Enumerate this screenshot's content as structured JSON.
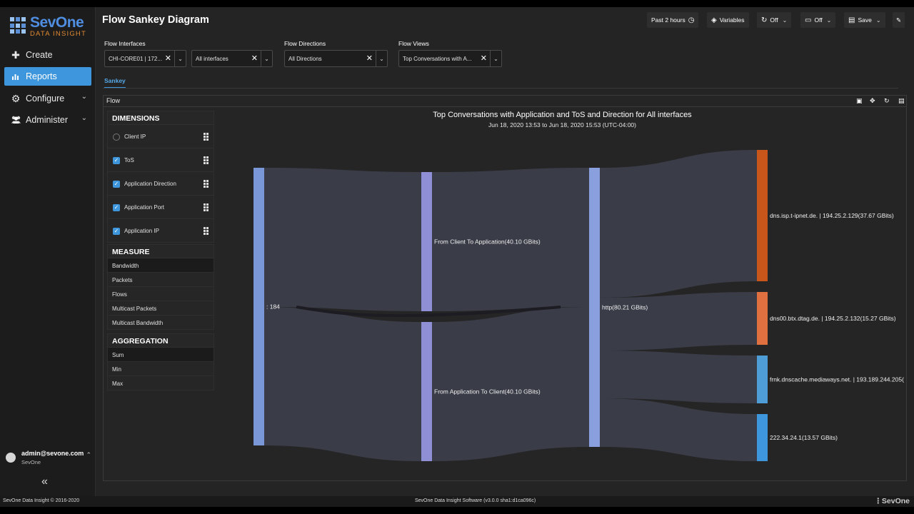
{
  "brand": {
    "name": "SevOne",
    "sub": "DATA INSIGHT"
  },
  "sidebar": {
    "items": [
      {
        "label": "Create",
        "icon": "plus-icon"
      },
      {
        "label": "Reports",
        "icon": "bar-chart-icon"
      },
      {
        "label": "Configure",
        "icon": "gear-icon"
      },
      {
        "label": "Administer",
        "icon": "users-icon"
      }
    ],
    "user": {
      "name": "admin@sevone.com",
      "org": "SevOne"
    },
    "collapse": "«"
  },
  "header": {
    "title": "Flow Sankey Diagram",
    "time_range": "Past 2 hours",
    "variables": "Variables",
    "refresh": "Off",
    "display": "Off",
    "save": "Save"
  },
  "filters": [
    {
      "label": "Flow Interfaces",
      "value": "CHI-CORE01 | 172...",
      "extra": "All interfaces"
    },
    {
      "label": "Flow Directions",
      "value": "All Directions"
    },
    {
      "label": "Flow Views",
      "value": "Top Conversations with A..."
    }
  ],
  "tab": "Sankey",
  "panel": {
    "title": "Flow"
  },
  "dimensions": {
    "title": "DIMENSIONS",
    "items": [
      {
        "label": "Client IP",
        "checked": false
      },
      {
        "label": "ToS",
        "checked": true
      },
      {
        "label": "Application Direction",
        "checked": true
      },
      {
        "label": "Application Port",
        "checked": true
      },
      {
        "label": "Application IP",
        "checked": true
      }
    ]
  },
  "measure": {
    "title": "MEASURE",
    "items": [
      "Bandwidth",
      "Packets",
      "Flows",
      "Multicast Packets",
      "Multicast Bandwidth"
    ],
    "selected": "Bandwidth"
  },
  "aggregation": {
    "title": "AGGREGATION",
    "items": [
      "Sum",
      "Min",
      "Max"
    ],
    "selected": "Sum"
  },
  "chart": {
    "title": "Top Conversations with Application and ToS and Direction for All interfaces",
    "subtitle": "Jun 18, 2020 13:53 to Jun 18, 2020 15:53 (UTC-04:00)"
  },
  "chart_data": {
    "type": "sankey",
    "unit": "GBits",
    "nodes": [
      {
        "id": "tos",
        "label": ": 184",
        "stage": 0,
        "color": "#7a98d8"
      },
      {
        "id": "c2a",
        "label": "From Client To Application(40.10 GBits)",
        "stage": 1,
        "color": "#8f8fd6",
        "value": 40.1
      },
      {
        "id": "a2c",
        "label": "From Application To Client(40.10 GBits)",
        "stage": 1,
        "color": "#8f8fd6",
        "value": 40.1
      },
      {
        "id": "http",
        "label": "http(80.21 GBits)",
        "stage": 2,
        "color": "#8aa0de",
        "value": 80.21
      },
      {
        "id": "ip1",
        "label": "dns.isp.t-ipnet.de. | 194.25.2.129(37.67 GBits)",
        "stage": 3,
        "color": "#c8561b",
        "value": 37.67
      },
      {
        "id": "ip2",
        "label": "dns00.btx.dtag.de. | 194.25.2.132(15.27 GBits)",
        "stage": 3,
        "color": "#e07040",
        "value": 15.27
      },
      {
        "id": "ip3",
        "label": "frnk.dnscache.mediaways.net. | 193.189.244.205(",
        "stage": 3,
        "color": "#4f9dd6",
        "value": 6.5
      },
      {
        "id": "ip4",
        "label": "222.34.24.1(13.57 GBits)",
        "stage": 3,
        "color": "#3e96dc",
        "value": 13.57
      }
    ]
  },
  "footer": {
    "left": "SevOne Data Insight © 2016-2020",
    "center": "SevOne Data Insight Software (v3.0.0 sha1:d1ca096c)",
    "right": "SevOne"
  }
}
